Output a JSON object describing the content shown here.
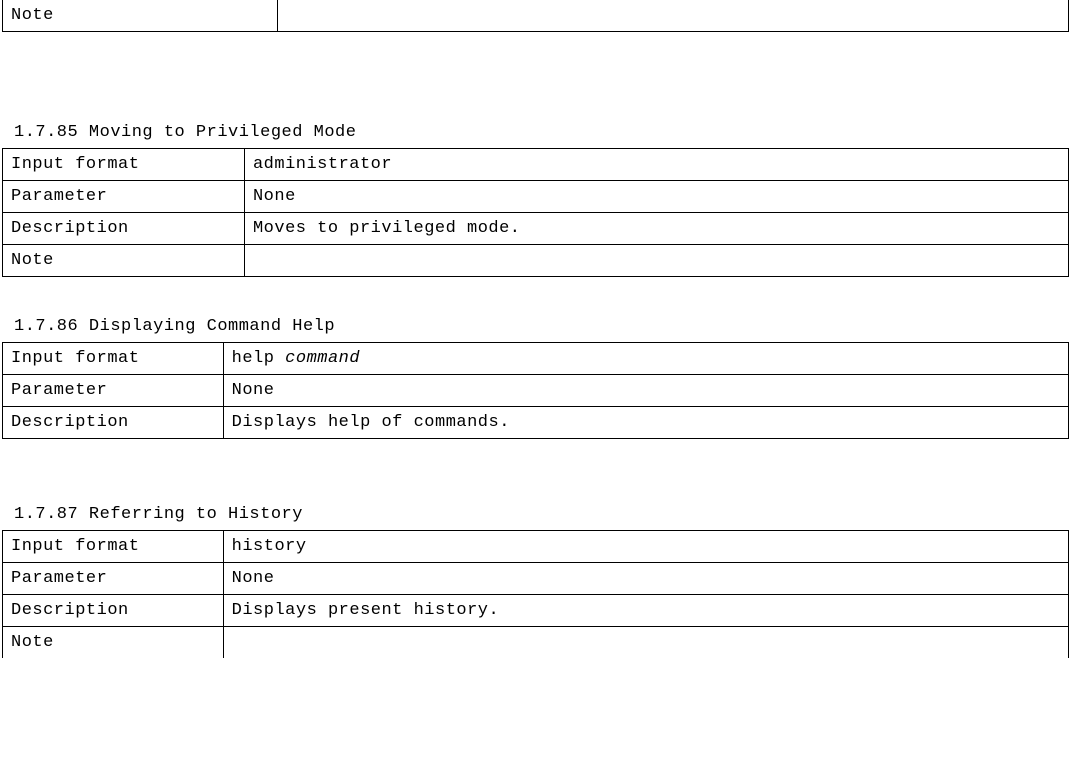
{
  "topFragment": {
    "noteLabel": "Note",
    "noteValue": ""
  },
  "sections": [
    {
      "id": "s85",
      "heading": "1.7.85 Moving to Privileged Mode",
      "inputFormatLabel": "Input format",
      "inputFormatValue": "administrator",
      "parameterLabel": "Parameter",
      "parameterValue": " None",
      "descriptionLabel": "Description",
      "descriptionValue": " Moves to privileged mode.",
      "noteLabel": "Note",
      "noteValue": ""
    },
    {
      "id": "s86",
      "heading": "1.7.86 Displaying Command Help",
      "inputFormatLabel": "Input format",
      "inputFormatPrefix": "help ",
      "inputFormatItalic": "command",
      "parameterLabel": "Parameter",
      "parameterValue": "None",
      "descriptionLabel": "Description",
      "descriptionValue": "Displays help of commands."
    },
    {
      "id": "s87",
      "heading": "1.7.87 Referring to History",
      "inputFormatLabel": "Input format",
      "inputFormatValue": "history",
      "parameterLabel": "Parameter",
      "parameterValue": "None",
      "descriptionLabel": "Description",
      "descriptionValue": "Displays present history.",
      "noteLabel": "Note",
      "noteValue": ""
    }
  ]
}
